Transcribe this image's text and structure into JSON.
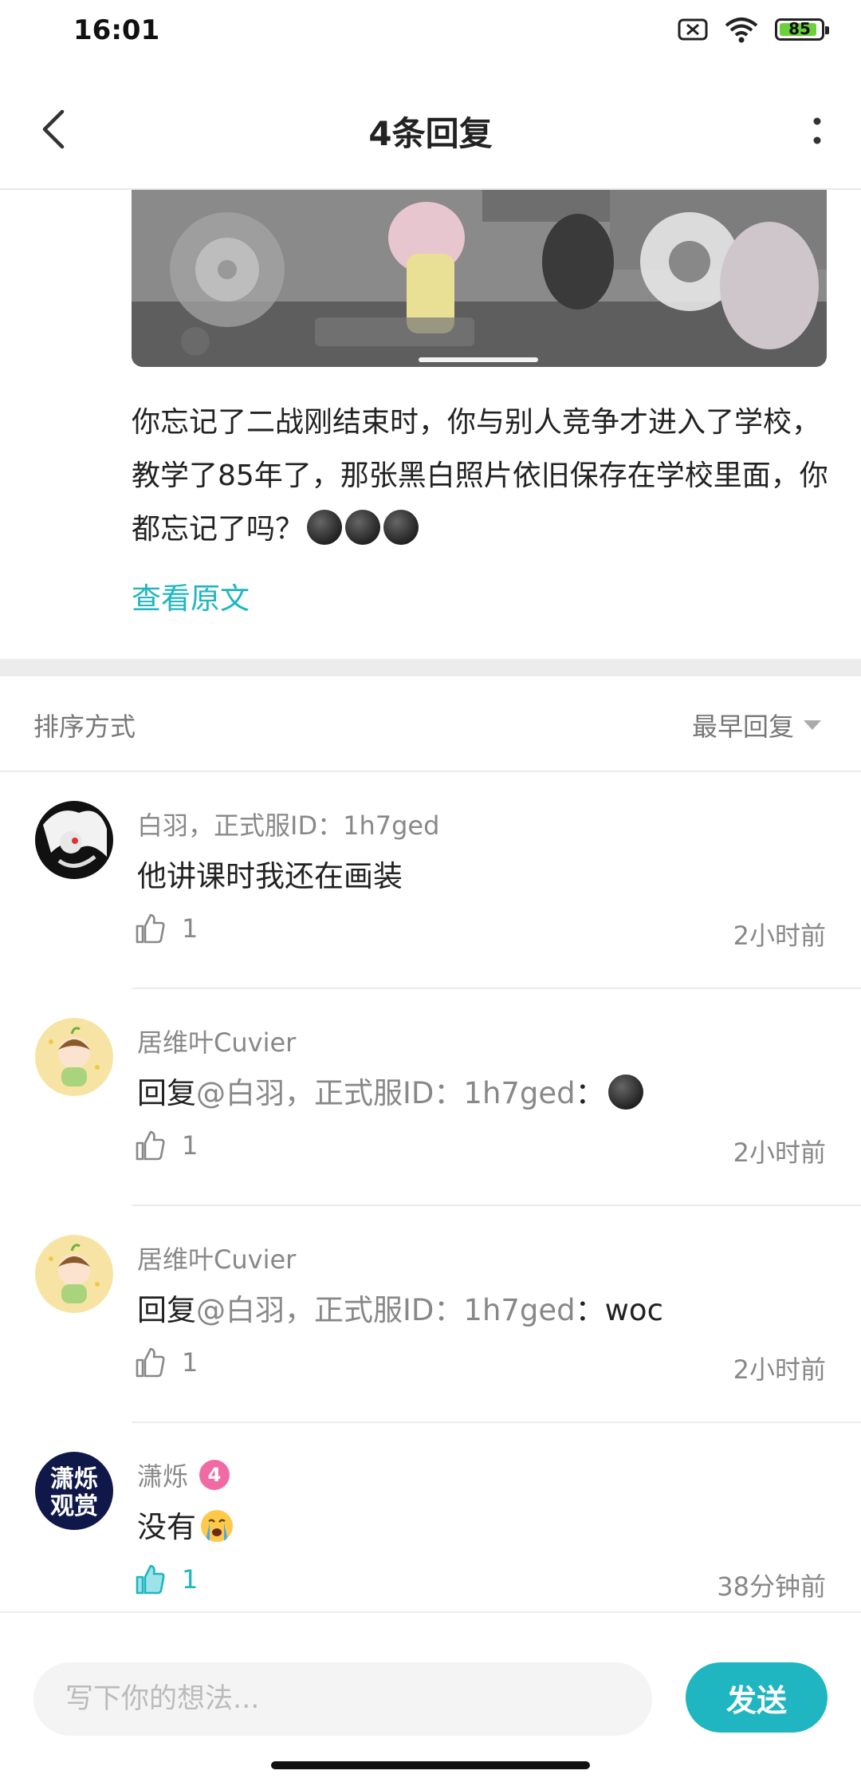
{
  "status_bar": {
    "time": "16:01",
    "battery": "85"
  },
  "header": {
    "title": "4条回复"
  },
  "post": {
    "text": "你忘记了二战刚结束时，你与别人竞争才进入了学校，教学了85年了，那张黑白照片依旧保存在学校里面，你都忘记了吗？",
    "view_original": "查看原文"
  },
  "sort": {
    "label": "排序方式",
    "value": "最早回复"
  },
  "comments": [
    {
      "name": "白羽，正式服ID：1h7ged",
      "body": "他讲课时我还在画装",
      "likes": "1",
      "time": "2小时前"
    },
    {
      "name": "居维叶Cuvier",
      "reply_prefix": "回复",
      "reply_target": "@白羽，正式服ID：1h7ged",
      "reply_sep": "：",
      "likes": "1",
      "time": "2小时前"
    },
    {
      "name": "居维叶Cuvier",
      "reply_prefix": "回复",
      "reply_target": "@白羽，正式服ID：1h7ged",
      "reply_sep": "：",
      "reply_text": "woc",
      "likes": "1",
      "time": "2小时前"
    },
    {
      "name": "潇烁",
      "level": "4",
      "body": "没有",
      "likes": "1",
      "time": "38分钟前",
      "avatar_text_top": "潇烁",
      "avatar_text_bottom": "观赏"
    }
  ],
  "composer": {
    "placeholder": "写下你的想法...",
    "send": "发送"
  },
  "colors": {
    "accent": "#1fb6c1",
    "badge": "#f06ba4"
  }
}
